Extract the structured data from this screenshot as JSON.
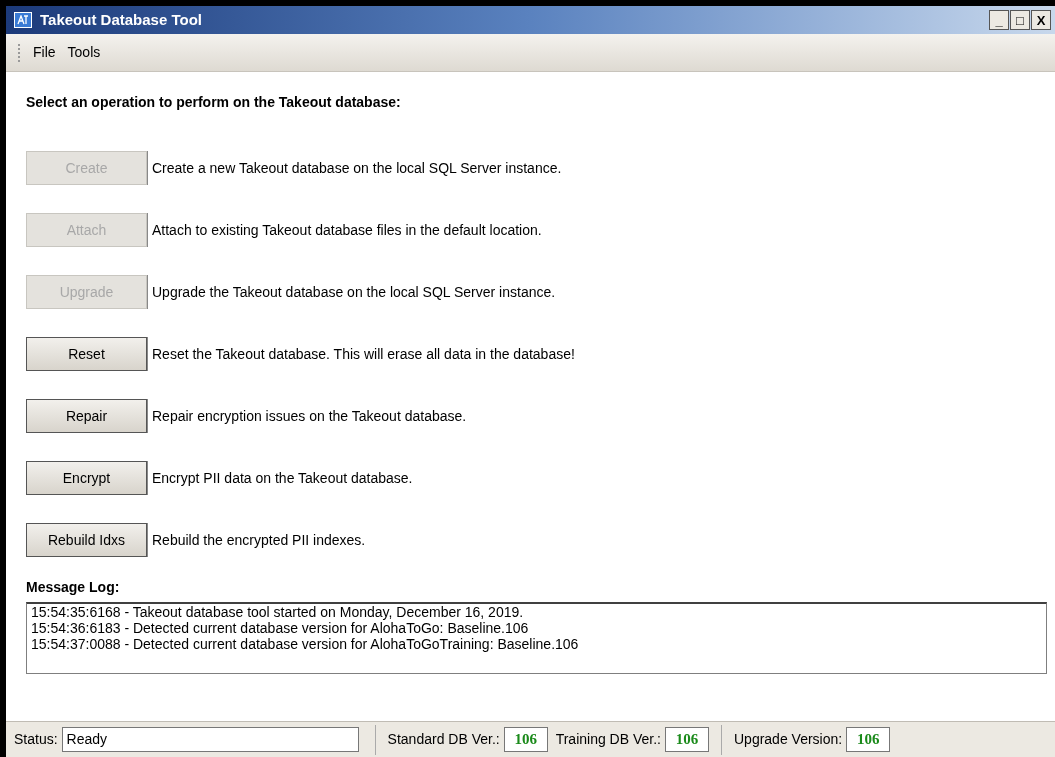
{
  "window": {
    "title": "Takeout Database Tool",
    "controls": [
      "_",
      "□",
      "X"
    ]
  },
  "menu": [
    {
      "label": "File"
    },
    {
      "label": "Tools"
    }
  ],
  "heading": "Select an operation to perform on the Takeout database:",
  "operations": [
    {
      "button": "Create",
      "disabled": true,
      "description": "Create a new Takeout database on the local SQL Server instance."
    },
    {
      "button": "Attach",
      "disabled": true,
      "description": "Attach to existing Takeout database files in the default location."
    },
    {
      "button": "Upgrade",
      "disabled": true,
      "description": "Upgrade the Takeout database on the local SQL Server instance."
    },
    {
      "button": "Reset",
      "disabled": false,
      "description": "Reset the Takeout database. This will erase all data in the database!"
    },
    {
      "button": "Repair",
      "disabled": false,
      "description": "Repair encryption issues on the Takeout database."
    },
    {
      "button": "Encrypt",
      "disabled": false,
      "description": "Encrypt PII data on the Takeout database."
    },
    {
      "button": "Rebuild Idxs",
      "disabled": false,
      "description": "Rebuild the encrypted PII indexes."
    }
  ],
  "message_log": {
    "label": "Message Log:",
    "lines": [
      "15:54:35:6168 - Takeout database tool started on Monday, December 16, 2019.",
      "15:54:36:6183 - Detected current database version for AlohaToGo: Baseline.106",
      "15:54:37:0088 - Detected current database version for AlohaToGoTraining: Baseline.106"
    ]
  },
  "status_bar": {
    "status_label": "Status:",
    "status_value": "Ready",
    "fields": [
      {
        "label": "Standard DB Ver.:",
        "value": "106"
      },
      {
        "label": "Training DB Ver.:",
        "value": "106"
      },
      {
        "label": "Upgrade Version:",
        "value": "106"
      }
    ]
  }
}
